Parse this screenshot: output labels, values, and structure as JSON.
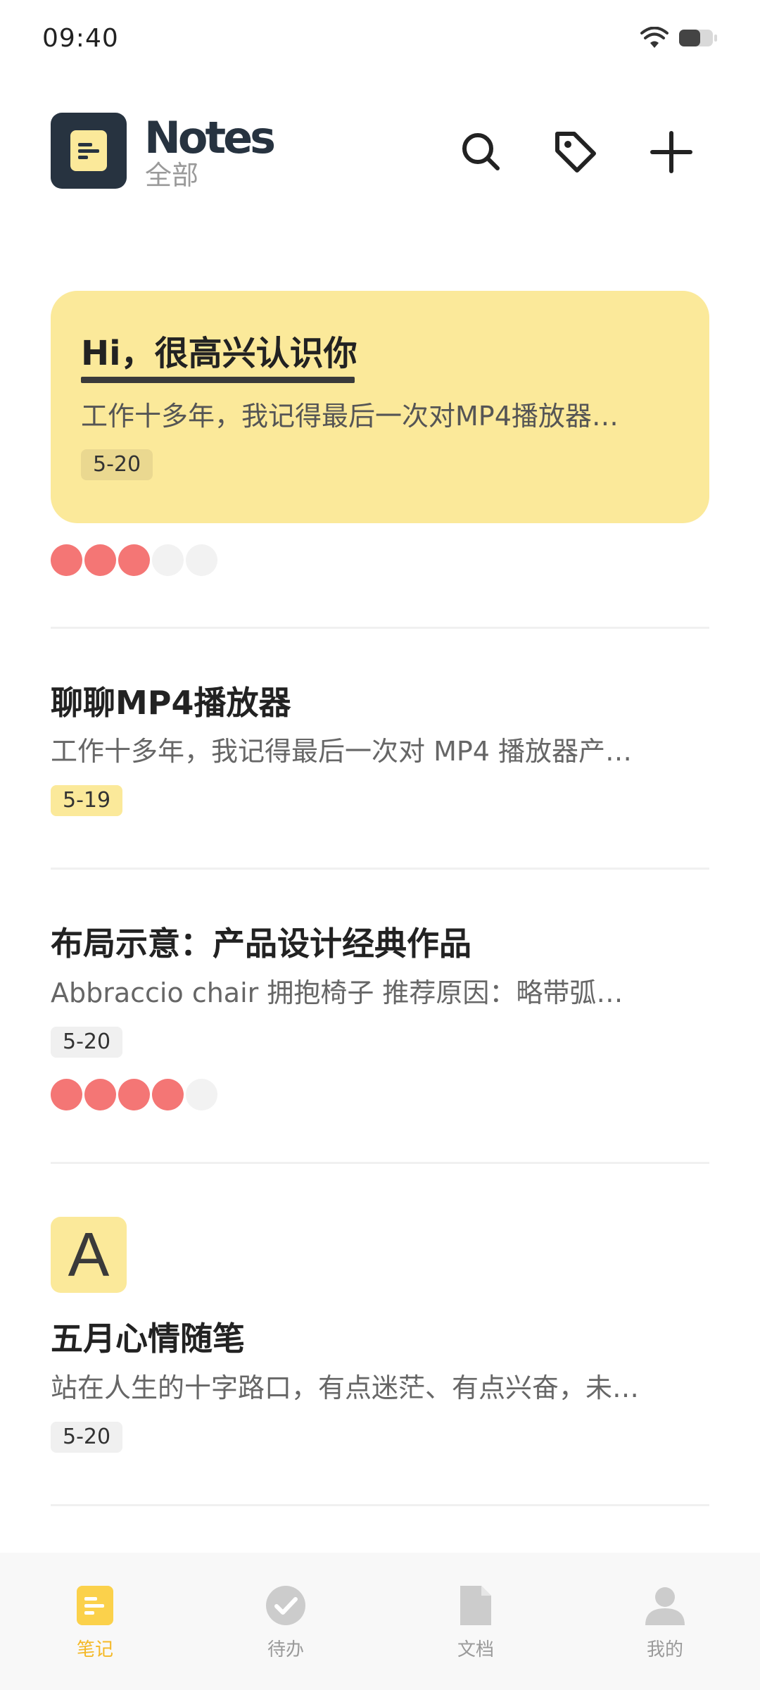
{
  "status_bar": {
    "time": "09:40"
  },
  "header": {
    "title": "Notes",
    "subtitle": "全部"
  },
  "notes": [
    {
      "title": "Hi，很高兴认识你",
      "excerpt": "工作十多年，我记得最后一次对MP4播放器…",
      "date": "5-20",
      "rating": 3,
      "rating_max": 5,
      "featured": true
    },
    {
      "title": "聊聊MP4播放器",
      "excerpt": "工作十多年，我记得最后一次对 MP4 播放器产…",
      "date": "5-19"
    },
    {
      "title": "布局示意：产品设计经典作品",
      "excerpt": "Abbraccio chair 拥抱椅子 推荐原因：略带弧…",
      "date": "5-20",
      "rating": 4,
      "rating_max": 5
    },
    {
      "letter": "A",
      "title": "五月心情随笔",
      "excerpt": "站在人生的十字路口，有点迷茫、有点兴奋，未…",
      "date": "5-20"
    }
  ],
  "bottom_nav": [
    {
      "label": "笔记",
      "icon": "note-icon",
      "active": true
    },
    {
      "label": "待办",
      "icon": "check-icon",
      "active": false
    },
    {
      "label": "文档",
      "icon": "document-icon",
      "active": false
    },
    {
      "label": "我的",
      "icon": "profile-icon",
      "active": false
    }
  ],
  "colors": {
    "accent": "#f4b826",
    "note_yellow": "#fbe99a",
    "rating_on": "#f47675",
    "logo_bg": "#273340"
  }
}
